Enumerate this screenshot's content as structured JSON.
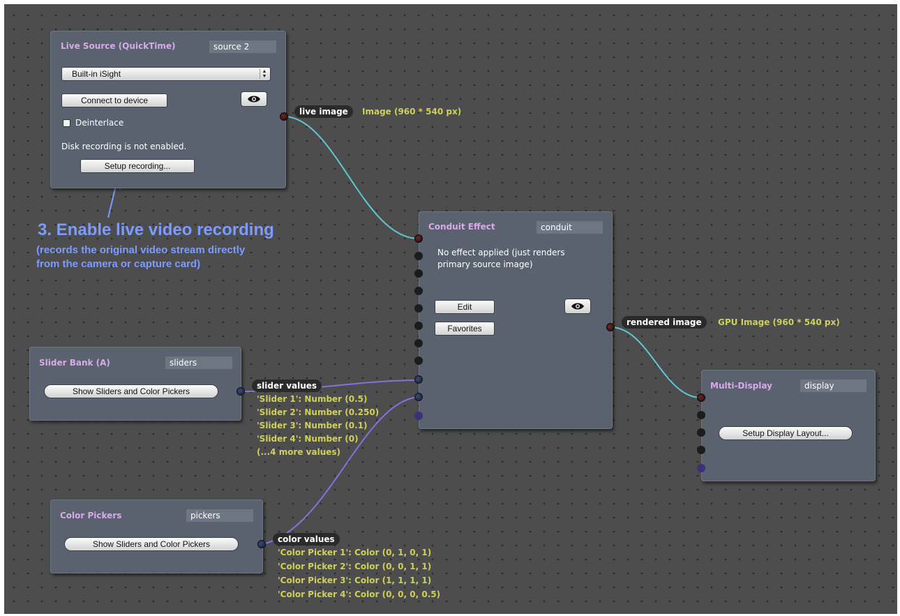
{
  "live_source": {
    "title": "Live Source (QuickTime)",
    "id": "source 2",
    "device": "Built-in iSight",
    "connect_label": "Connect to device",
    "deinterlace_label": "Deinterlace",
    "deinterlace_checked": false,
    "status": "Disk recording is not enabled.",
    "setup_recording_label": "Setup recording...",
    "output_label": "live image",
    "output_info": "Image (960 * 540 px)"
  },
  "annotation": {
    "title": "3. Enable live video recording",
    "line1": "(records the original video stream directly",
    "line2": "from the camera or capture card)"
  },
  "conduit": {
    "title": "Conduit Effect",
    "id": "conduit",
    "description_line1": "No effect applied (just renders",
    "description_line2": "primary source image)",
    "edit_label": "Edit",
    "favorites_label": "Favorites",
    "output_label": "rendered image",
    "output_info": "GPU Image (960 * 540 px)"
  },
  "slider_bank": {
    "title": "Slider Bank (A)",
    "id": "sliders",
    "button_label": "Show Sliders and Color Pickers",
    "output_label": "slider values",
    "values": [
      "'Slider 1': Number (0.5)",
      "'Slider 2': Number (0.250)",
      "'Slider 3': Number (0.1)",
      "'Slider 4': Number (0)",
      "(...4 more values)"
    ]
  },
  "color_pickers": {
    "title": "Color Pickers",
    "id": "pickers",
    "button_label": "Show Sliders and Color Pickers",
    "output_label": "color values",
    "values": [
      "'Color Picker 1': Color (0, 1, 0, 1)",
      "'Color Picker 2': Color (0, 0, 1, 1)",
      "'Color Picker 3': Color (1, 1, 1, 1)",
      "'Color Picker 4': Color (0, 0, 0, 0.5)"
    ]
  },
  "multi_display": {
    "title": "Multi-Display",
    "id": "display",
    "button_label": "Setup Display Layout..."
  },
  "colors": {
    "canvas": "#4d4d4d",
    "node_bg": "#5a6270",
    "node_title": "#d9a9e8",
    "info_text": "#cfd05a",
    "annotation": "#7d9bff",
    "image_wire": "#5fc6d8",
    "value_wire": "#8a6fe0"
  },
  "icons": [
    "eye-icon",
    "arrow-up-icon",
    "select-arrows-icon"
  ]
}
